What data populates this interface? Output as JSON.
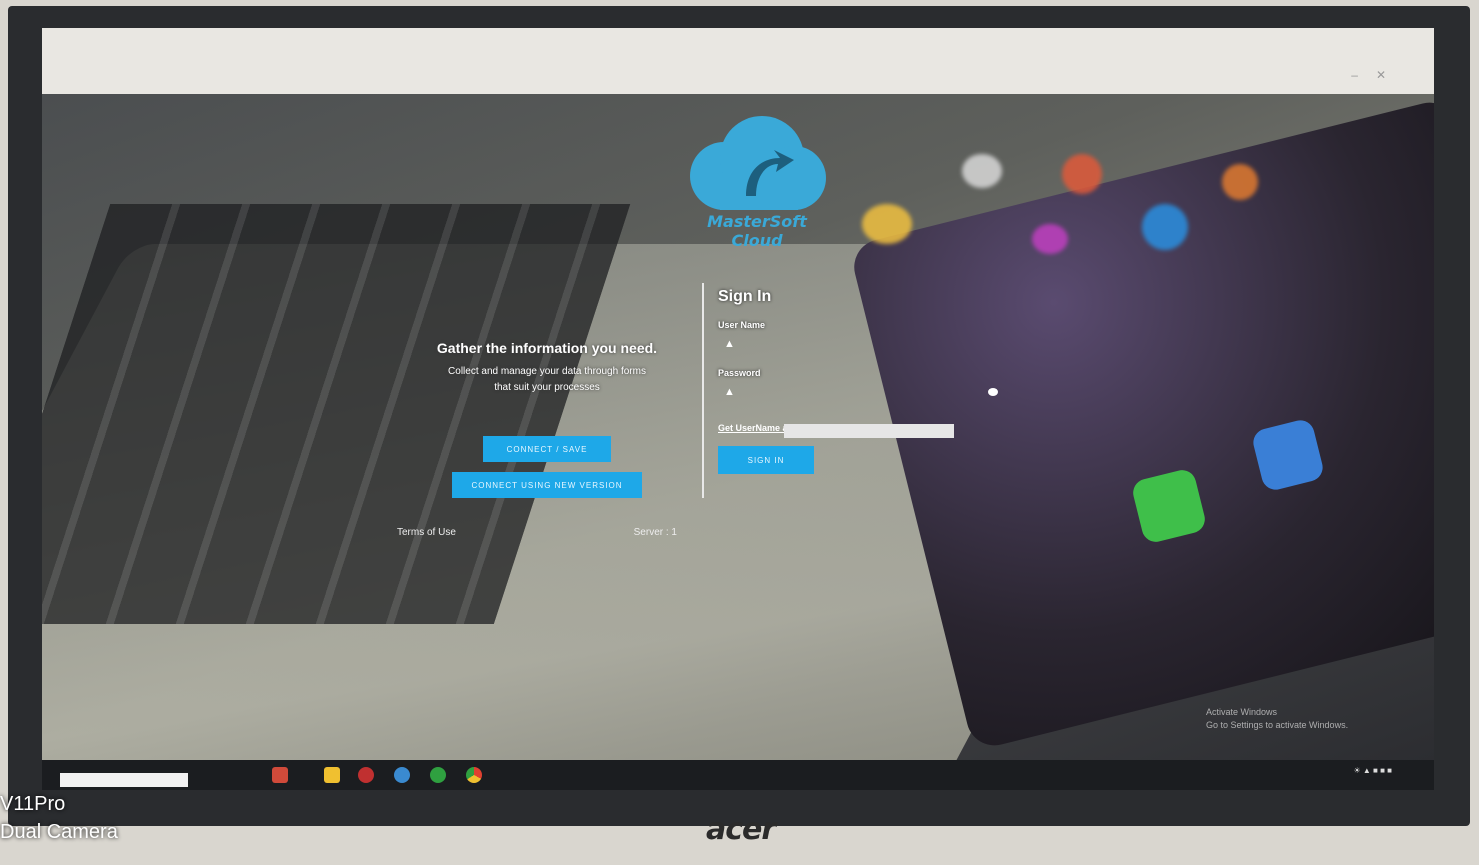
{
  "app": {
    "name": "MasterSoft Cloud",
    "logo_icon": "cloud-arrow-icon",
    "accent_color": "#1ea8e8"
  },
  "info_panel": {
    "heading": "Gather the information you need.",
    "description": "Collect and manage your data through forms",
    "description_line2": "that suit your processes",
    "connect_button": "CONNECT / SAVE",
    "connect_new_button": "CONNECT USING NEW VERSION",
    "terms_link": "Terms of Use",
    "server_text": "Server : 1"
  },
  "signin": {
    "title": "Sign In",
    "username_label": "User Name",
    "username_icon": "user-icon",
    "password_label": "Password",
    "password_icon": "lock-icon",
    "show_password_icon": "eye-icon",
    "forgot_link": "Get UserName and Password",
    "signin_button": "SIGN IN"
  },
  "windows": {
    "activate_title": "Activate Windows",
    "activate_subtitle": "Go to Settings to activate Windows."
  },
  "camera_watermark": {
    "line1": "V11Pro",
    "line2": "Dual Camera"
  },
  "monitor_brand": "acer"
}
